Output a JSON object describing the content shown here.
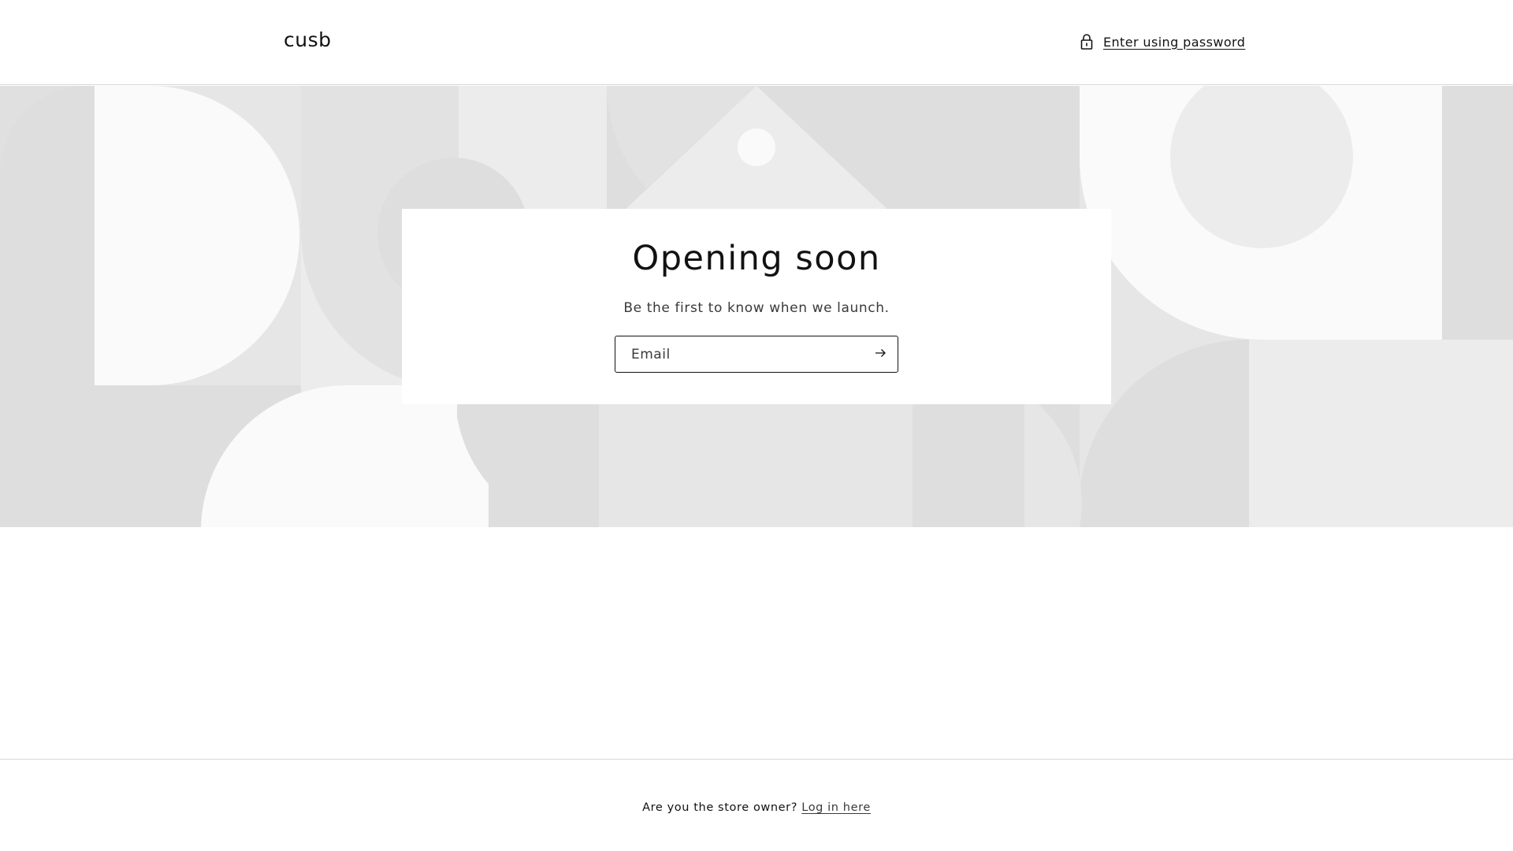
{
  "header": {
    "store_name": "cusb",
    "password_link": {
      "icon": "lock-icon",
      "label": "Enter using password"
    }
  },
  "banner": {
    "colors": {
      "light": "#fafafa",
      "mid": "#ececec",
      "dark": "#dedede",
      "base": "#e6e6e6"
    }
  },
  "newsletter": {
    "title": "Opening soon",
    "subtitle": "Be the first to know when we launch.",
    "email_placeholder": "Email",
    "submit_icon": "arrow-right-icon"
  },
  "footer": {
    "prompt": "Are you the store owner?",
    "login_label": "Log in here"
  }
}
